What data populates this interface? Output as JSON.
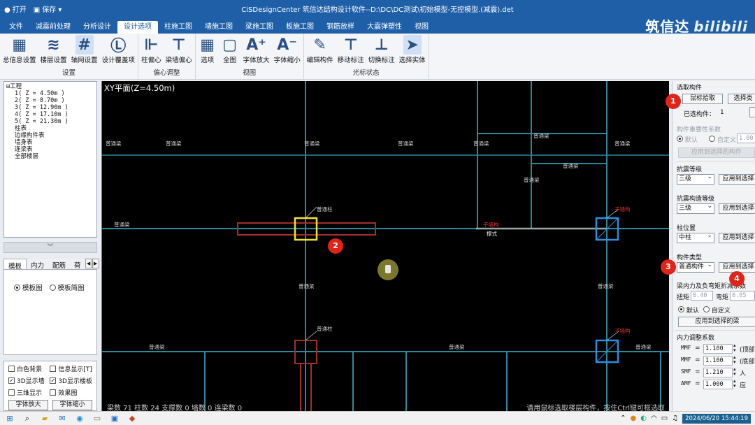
{
  "titlebar": {
    "open_label": "打开",
    "save_label": "保存",
    "title": "CiSDesignCenter 筑信达结构设计软件--D:\\DC\\DC测试\\初始模型-无控模型.(减震).det"
  },
  "menu": {
    "tabs": [
      "文件",
      "减震前处理",
      "分析设计",
      "设计选项",
      "柱施工图",
      "墙施工图",
      "梁施工图",
      "板施工图",
      "钢筋放样",
      "大震弹塑性",
      "视图"
    ],
    "active_index": 3
  },
  "brand": {
    "text": "筑信达",
    "watermark": "bilibili"
  },
  "ribbon": {
    "groups": [
      {
        "name": "设置",
        "buttons": [
          {
            "label": "总信息设置",
            "icon": "grid-settings-icon"
          },
          {
            "label": "楼层设置",
            "icon": "layers-icon"
          },
          {
            "label": "轴网设置",
            "icon": "axis-grid-icon"
          },
          {
            "label": "设计覆盖项",
            "icon": "lb-override-icon"
          }
        ]
      },
      {
        "name": "偏心调整",
        "buttons": [
          {
            "label": "柱偏心",
            "icon": "column-offset-icon"
          },
          {
            "label": "梁墙偏心",
            "icon": "beam-wall-offset-icon"
          }
        ]
      },
      {
        "name": "视图",
        "buttons": [
          {
            "label": "选项",
            "icon": "options-icon"
          },
          {
            "label": "全图",
            "icon": "fit-all-icon"
          },
          {
            "label": "字体放大",
            "icon": "font-increase-icon"
          },
          {
            "label": "字体缩小",
            "icon": "font-decrease-icon"
          }
        ]
      },
      {
        "name": "光标状态",
        "buttons": [
          {
            "label": "编辑构件",
            "icon": "edit-member-icon"
          },
          {
            "label": "移动标注",
            "icon": "move-annotation-icon"
          },
          {
            "label": "切换标注",
            "icon": "switch-annotation-icon"
          },
          {
            "label": "选择实体",
            "icon": "select-entity-icon"
          }
        ]
      }
    ]
  },
  "tree": {
    "root": "工程",
    "floors": [
      "1( Z = 4.50m )",
      "2( Z = 8.70m )",
      "3( Z = 12.90m )",
      "4( Z = 17.10m )",
      "5( Z = 21.30m )"
    ],
    "items": [
      "柱表",
      "边缘构件表",
      "墙身表",
      "连梁表",
      "全部楼层"
    ]
  },
  "left_tabs": {
    "tabs": [
      "模板",
      "内力",
      "配筋",
      "荷"
    ],
    "active_index": 0
  },
  "left_radio": {
    "options": [
      "模板图",
      "模板简图"
    ],
    "selected": 0
  },
  "checks": {
    "items": [
      {
        "label": "白色背景",
        "checked": false
      },
      {
        "label": "信息显示[T]",
        "checked": false
      },
      {
        "label": "3D显示墙",
        "checked": true
      },
      {
        "label": "3D显示楼板",
        "checked": true
      },
      {
        "label": "三维显示",
        "checked": false
      },
      {
        "label": "效果图",
        "checked": false
      }
    ],
    "font_up": "字体放大",
    "font_down": "字体缩小"
  },
  "canvas": {
    "title": "XY平面(Z=4.50m)",
    "beam_label": "普通梁",
    "column_label": "普通柱",
    "frame_column_label": "子墙构",
    "mark_label": "撑式",
    "status_left": "梁数 71 柱数 24 支撑数 0 墙数 0 连梁数 0",
    "status_right": "请用鼠标选取楼层构件，按住Ctrl键可框选取"
  },
  "right_panel": {
    "section_select": "选取构件",
    "pick_button": "鼠标拾取",
    "select_button": "选择类",
    "selected_count_label": "已选构件：",
    "selected_count": "1",
    "importance_label": "构件重要性系数",
    "default_label": "默认",
    "custom_label": "自定义",
    "importance_value": "1.00",
    "apply_selected": "应用到选择的构件",
    "seismic_grade_label": "抗震等级",
    "seismic_grade_value": "三级",
    "seismic_structural_label": "抗震构造等级",
    "seismic_structural_value": "三级",
    "apply_short": "应用到选择",
    "column_position_label": "柱位置",
    "column_position_value": "中柱",
    "member_type_label": "构件类型",
    "member_type_value": "普通构件",
    "beam_force_label": "梁内力及负弯矩折减系数",
    "torsion_label": "扭矩",
    "torsion_value": "0.40",
    "moment_label": "弯矩",
    "moment_value": "0.85",
    "apply_beam": "应用到选择的梁",
    "force_adjust_label": "内力调整系数",
    "coeffs": [
      {
        "name": "MMF",
        "value": "1.100",
        "suffix": "(顶部"
      },
      {
        "name": "MMF",
        "value": "1.100",
        "suffix": "(底部"
      },
      {
        "name": "SMF",
        "value": "1.210",
        "suffix": "人"
      },
      {
        "name": "AMF",
        "value": "1.000",
        "suffix": "应"
      }
    ]
  },
  "badges": [
    "1",
    "2",
    "3",
    "4"
  ],
  "taskbar": {
    "clock": "2024/06/20 15:44:19"
  },
  "colors": {
    "titlebar": "#1f5fa8",
    "beam": "#2a8a9c",
    "column_selected": "#f2e230",
    "column_blue": "#2c8fe0",
    "column_red": "#a0302a",
    "badge": "#e0241a"
  }
}
